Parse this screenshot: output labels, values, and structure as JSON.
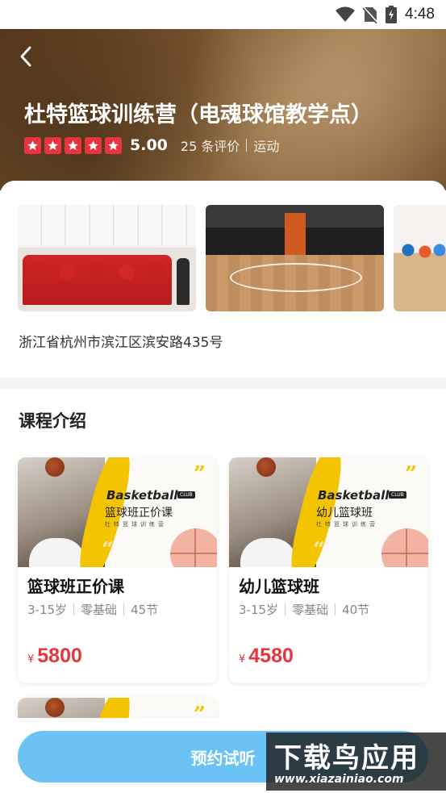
{
  "status_bar": {
    "time": "4:48"
  },
  "header": {
    "title": "杜特篮球训练营（电魂球馆教学点）",
    "rating": "5.00",
    "review_count": "25 条评价",
    "category": "运动",
    "stars": 5
  },
  "venue": {
    "address": "浙江省杭州市滨江区滨安路435号"
  },
  "courses_section": {
    "title": "课程介绍"
  },
  "courses": [
    {
      "name": "篮球班正价课",
      "age": "3-15岁",
      "level": "零基础",
      "lessons": "45节",
      "currency": "¥",
      "price": "5800",
      "banner_brand": "Basketball",
      "banner_badge": "CLUB",
      "banner_title": "篮球班正价课",
      "banner_sub": "杜特篮球训练营"
    },
    {
      "name": "幼儿篮球班",
      "age": "3-15岁",
      "level": "零基础",
      "lessons": "40节",
      "currency": "¥",
      "price": "4580",
      "banner_brand": "Basketball",
      "banner_badge": "CLUB",
      "banner_title": "幼儿篮球班",
      "banner_sub": "杜特篮球训练营"
    }
  ],
  "action": {
    "book_label": "预约试听"
  },
  "watermark": {
    "cn": "下载鸟应用",
    "en": "www.xiazainiao.com"
  },
  "colors": {
    "accent_red": "#e8343f",
    "button_blue": "#6ac2f5",
    "banner_yellow": "#f5c400"
  }
}
